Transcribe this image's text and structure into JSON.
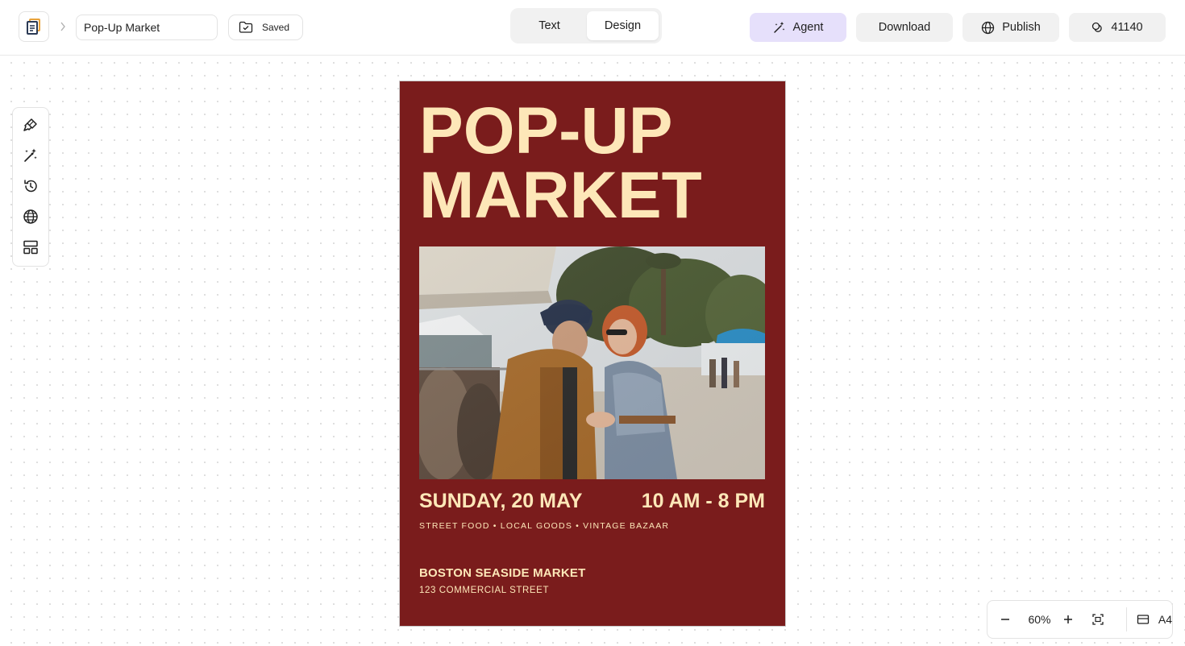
{
  "header": {
    "document_title": "Pop-Up Market",
    "save_status": "Saved",
    "mode_tabs": [
      {
        "label": "Text",
        "active": false
      },
      {
        "label": "Design",
        "active": true
      }
    ],
    "agent_label": "Agent",
    "download_label": "Download",
    "publish_label": "Publish",
    "credits": "41140"
  },
  "tool_rail": {
    "tools": [
      "brush-icon",
      "magic-wand-icon",
      "history-icon",
      "globe-icon",
      "layout-icon"
    ]
  },
  "poster": {
    "headline_line1": "POP-UP",
    "headline_line2": "MARKET",
    "date": "SUNDAY, 20 MAY",
    "time": "10 AM - 8 PM",
    "tagline": "STREET FOOD • LOCAL GOODS • VINTAGE BAZAAR",
    "venue": "BOSTON SEASIDE MARKET",
    "address": "123 COMMERCIAL STREET",
    "background_color": "#7a1c1c",
    "text_color": "#fde7b8"
  },
  "zoom": {
    "level": "60%",
    "page_size": "A4"
  },
  "colors": {
    "agent_bg": "#e6e0fb",
    "button_bg": "#f1f1f1"
  }
}
